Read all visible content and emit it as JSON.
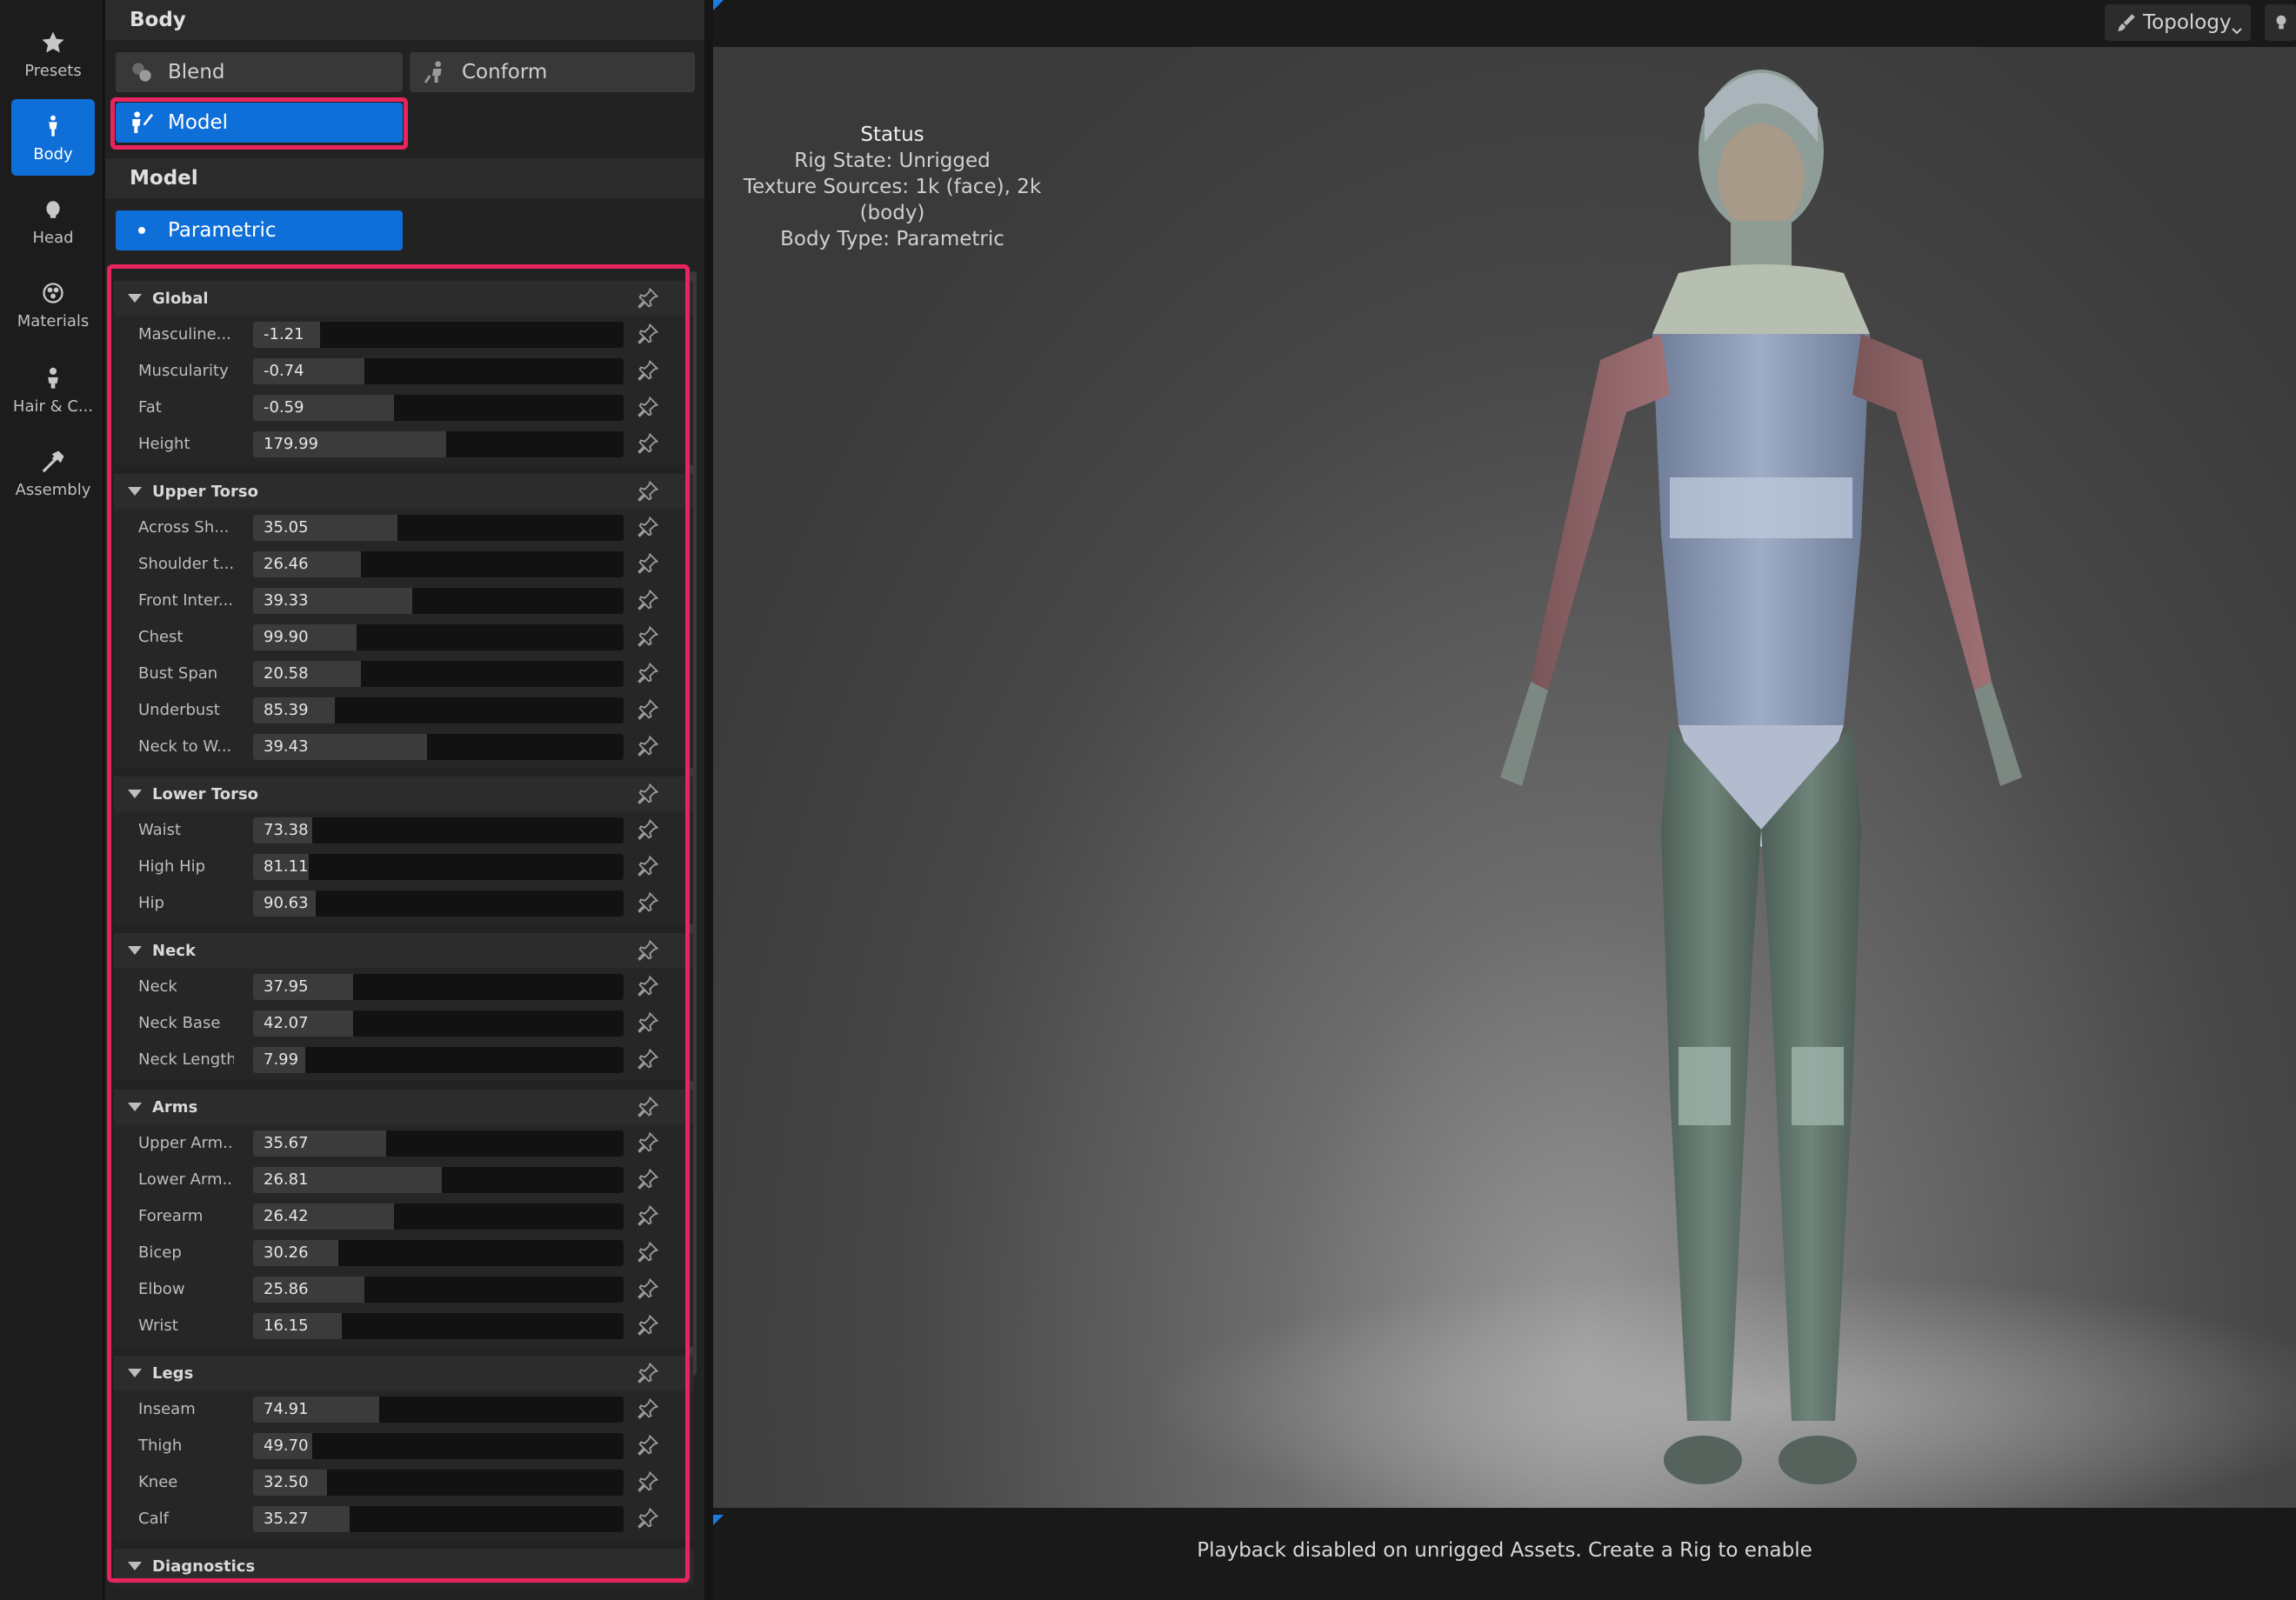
{
  "rail": {
    "items": [
      {
        "label": "Presets",
        "icon": "star-icon"
      },
      {
        "label": "Body",
        "icon": "body-icon"
      },
      {
        "label": "Head",
        "icon": "head-icon"
      },
      {
        "label": "Materials",
        "icon": "materials-icon"
      },
      {
        "label": "Hair & C...",
        "icon": "hair-icon"
      },
      {
        "label": "Assembly",
        "icon": "hammer-icon"
      }
    ],
    "active": "Body",
    "active_color": "#0f6fd8"
  },
  "panel": {
    "title": "Body",
    "buttons": {
      "blend": "Blend",
      "conform": "Conform",
      "model": "Model"
    },
    "model_section": "Model",
    "parametric": "Parametric",
    "highlight_color": "#e8245e",
    "groups": [
      {
        "title": "Global",
        "params": [
          {
            "label": "Masculine...",
            "value": "-1.21",
            "fill": 0.18
          },
          {
            "label": "Muscularity",
            "value": "-0.74",
            "fill": 0.3
          },
          {
            "label": "Fat",
            "value": "-0.59",
            "fill": 0.38
          },
          {
            "label": "Height",
            "value": "179.99",
            "fill": 0.52
          }
        ]
      },
      {
        "title": "Upper Torso",
        "params": [
          {
            "label": "Across Sh...",
            "value": "35.05",
            "fill": 0.39
          },
          {
            "label": "Shoulder t...",
            "value": "26.46",
            "fill": 0.29
          },
          {
            "label": "Front Inter...",
            "value": "39.33",
            "fill": 0.43
          },
          {
            "label": "Chest",
            "value": "99.90",
            "fill": 0.28
          },
          {
            "label": "Bust Span",
            "value": "20.58",
            "fill": 0.29
          },
          {
            "label": "Underbust",
            "value": "85.39",
            "fill": 0.22
          },
          {
            "label": "Neck to W...",
            "value": "39.43",
            "fill": 0.47
          }
        ]
      },
      {
        "title": "Lower Torso",
        "params": [
          {
            "label": "Waist",
            "value": "73.38",
            "fill": 0.16
          },
          {
            "label": "High Hip",
            "value": "81.11",
            "fill": 0.15
          },
          {
            "label": "Hip",
            "value": "90.63",
            "fill": 0.17
          }
        ]
      },
      {
        "title": "Neck",
        "params": [
          {
            "label": "Neck",
            "value": "37.95",
            "fill": 0.27
          },
          {
            "label": "Neck Base",
            "value": "42.07",
            "fill": 0.27
          },
          {
            "label": "Neck Length",
            "value": "7.99",
            "fill": 0.14
          }
        ]
      },
      {
        "title": "Arms",
        "params": [
          {
            "label": "Upper Arm...",
            "value": "35.67",
            "fill": 0.36
          },
          {
            "label": "Lower Arm...",
            "value": "26.81",
            "fill": 0.51
          },
          {
            "label": "Forearm",
            "value": "26.42",
            "fill": 0.38
          },
          {
            "label": "Bicep",
            "value": "30.26",
            "fill": 0.23
          },
          {
            "label": "Elbow",
            "value": "25.86",
            "fill": 0.3
          },
          {
            "label": "Wrist",
            "value": "16.15",
            "fill": 0.24
          }
        ]
      },
      {
        "title": "Legs",
        "params": [
          {
            "label": "Inseam",
            "value": "74.91",
            "fill": 0.34
          },
          {
            "label": "Thigh",
            "value": "49.70",
            "fill": 0.16
          },
          {
            "label": "Knee",
            "value": "32.50",
            "fill": 0.2
          },
          {
            "label": "Calf",
            "value": "35.27",
            "fill": 0.26
          }
        ]
      },
      {
        "title": "Diagnostics",
        "params": []
      }
    ]
  },
  "viewport": {
    "topology": "Topology",
    "status_title": "Status",
    "status_lines": [
      "Rig State: Unrigged",
      "Texture Sources: 1k (face), 2k (body)",
      "Body Type: Parametric"
    ],
    "playback": "Playback disabled on unrigged Assets. Create a Rig to enable"
  }
}
